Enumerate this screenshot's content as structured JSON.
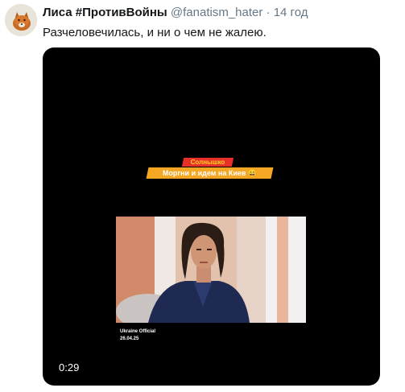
{
  "author": {
    "display_name": "Лиса #ПротивВойны",
    "handle": "@fanatism_hater",
    "separator": "·",
    "time": "14 год"
  },
  "tweet": {
    "text": "Разчеловечилась, и ни о чем не жалею."
  },
  "video": {
    "caption_top": "Солнышко",
    "caption_bottom": "Моргни и идем на Киев 😄",
    "watermark_source": "Ukraine Official",
    "watermark_date": "26.04.25",
    "duration": "0:29"
  }
}
